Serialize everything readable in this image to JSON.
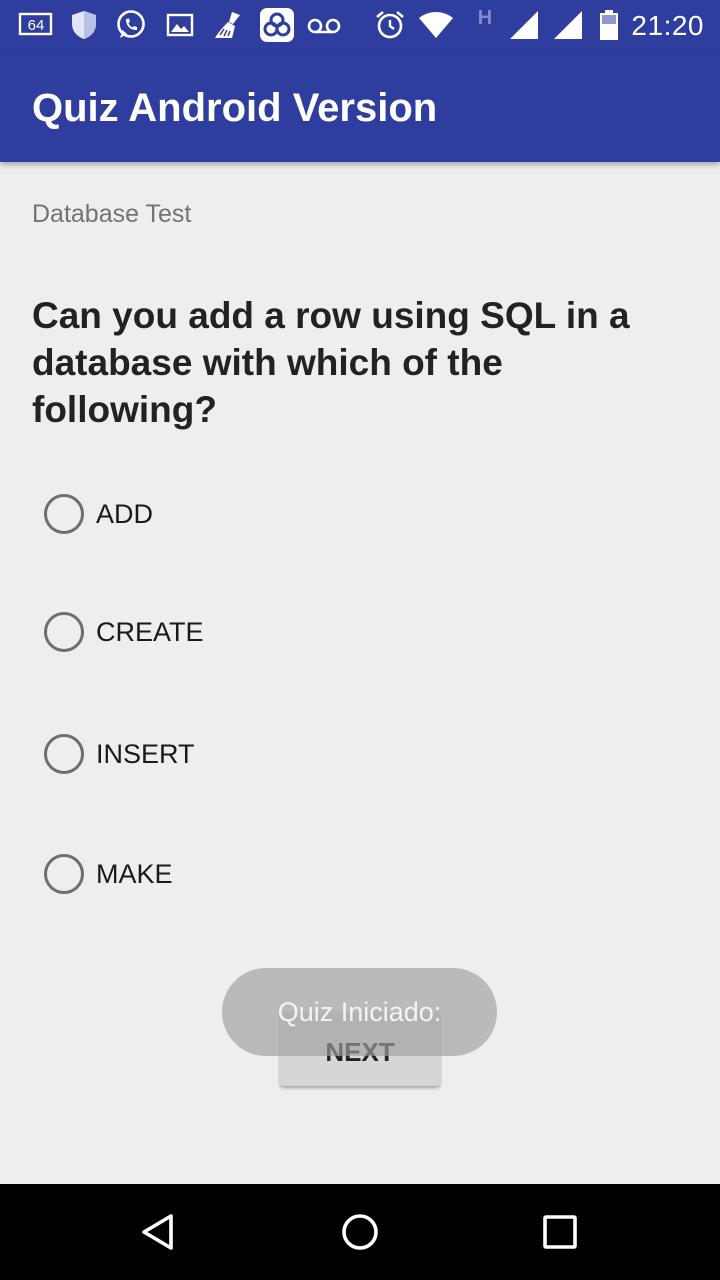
{
  "status_bar": {
    "time": "21:20",
    "left_icons": [
      "badge-64-icon",
      "shield-icon",
      "whatsapp-icon",
      "image-icon",
      "broom-icon",
      "app-tile-icon",
      "voicemail-icon"
    ],
    "right_icons": [
      "alarm-icon",
      "wifi-icon",
      "h-network-icon",
      "signal-icon",
      "signal-icon",
      "battery-icon"
    ],
    "badge_text": "64",
    "network_type": "H"
  },
  "app_bar": {
    "title": "Quiz Android Version",
    "color": "#2E3D9E"
  },
  "quiz": {
    "subtitle": "Database Test",
    "question": "Can you add a row using SQL in a database with which of the following?",
    "options": [
      {
        "label": "ADD",
        "selected": false
      },
      {
        "label": "CREATE",
        "selected": false
      },
      {
        "label": "INSERT",
        "selected": false
      },
      {
        "label": "MAKE",
        "selected": false
      }
    ],
    "next_label": "NEXT"
  },
  "toast": {
    "text": "Quiz Iniciado:"
  },
  "nav_bar": {
    "buttons": [
      "back-icon",
      "home-icon",
      "recents-icon"
    ]
  }
}
